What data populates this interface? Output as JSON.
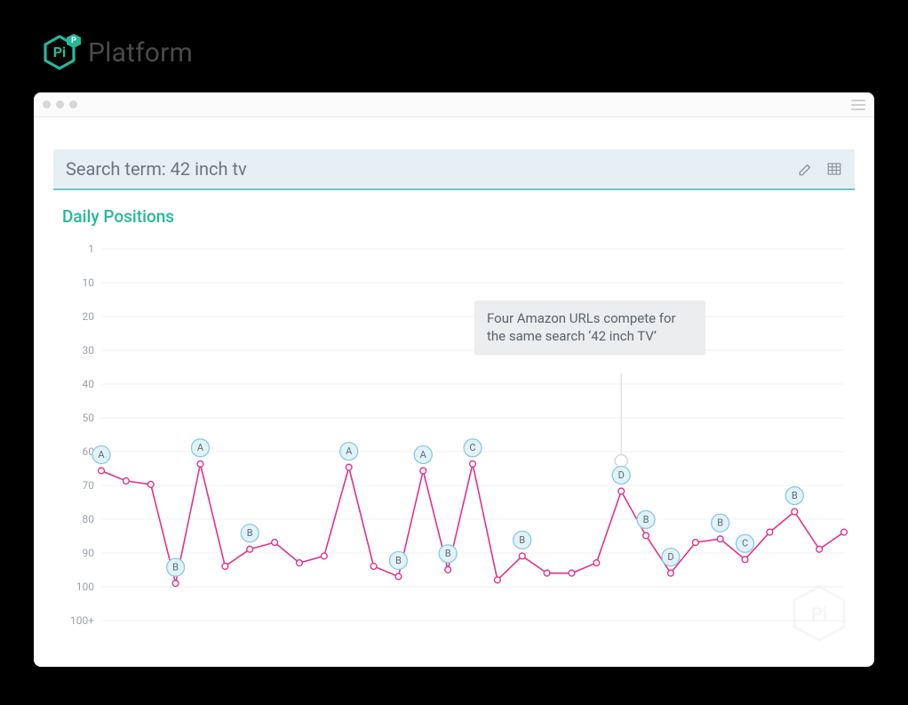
{
  "brand": {
    "name": "Platform"
  },
  "search": {
    "label": "Search term: 42 inch tv"
  },
  "section": {
    "title": "Daily Positions"
  },
  "annotation": {
    "line1": "Four Amazon URLs compete for",
    "line2": "the same search ‘42 inch TV’"
  },
  "watermark": "Pi",
  "chart_data": {
    "type": "line",
    "title": "Daily Positions",
    "xlabel": "",
    "ylabel": "",
    "y_ticks": [
      "1",
      "10",
      "20",
      "30",
      "40",
      "50",
      "60",
      "70",
      "80",
      "90",
      "100",
      "100+"
    ],
    "ylim_top": 1,
    "ylim_bottom": 100,
    "note": "Y axis is inverted rank position (1 at top). Values estimated from gridlines.",
    "x": [
      1,
      2,
      3,
      4,
      5,
      6,
      7,
      8,
      9,
      10,
      11,
      12,
      13,
      14,
      15,
      16,
      17,
      18,
      19,
      20,
      21,
      22,
      23,
      24,
      25,
      26,
      27,
      28,
      29,
      30,
      31
    ],
    "series": [
      {
        "name": "Position",
        "values": [
          66,
          69,
          70,
          99,
          64,
          94,
          89,
          87,
          93,
          91,
          65,
          94,
          97,
          66,
          95,
          64,
          98,
          91,
          96,
          96,
          93,
          72,
          85,
          96,
          87,
          86,
          92,
          84,
          78,
          89,
          84
        ],
        "point_labels": [
          "A",
          "",
          "",
          "B",
          "A",
          "",
          "B",
          "",
          "",
          "",
          "A",
          "",
          "B",
          "A",
          "B",
          "C",
          "",
          "B",
          "",
          "",
          "",
          "D",
          "B",
          "D",
          "",
          "B",
          "C",
          "",
          "B",
          "",
          ""
        ]
      }
    ]
  }
}
